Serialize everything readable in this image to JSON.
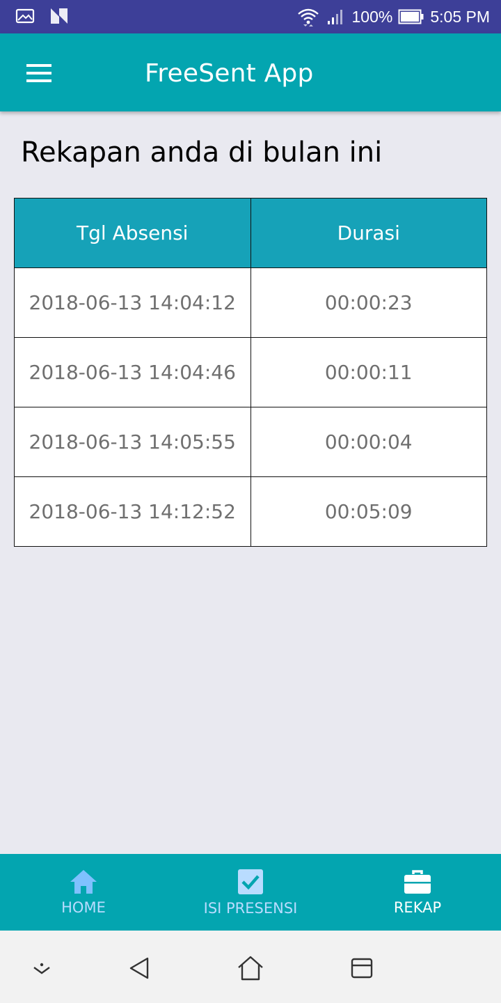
{
  "status_bar": {
    "left_icons": [
      "image-icon",
      "n-logo-icon"
    ],
    "right_icons": [
      "wifi-icon",
      "signal-icon",
      "battery-icon"
    ],
    "battery": "100%",
    "time": "5:05 PM"
  },
  "app_bar": {
    "menu_icon": "hamburger-menu-icon",
    "title": "FreeSent App"
  },
  "main": {
    "heading": "Rekapan anda di bulan ini",
    "table": {
      "columns": [
        "Tgl Absensi",
        "Durasi"
      ],
      "rows": [
        [
          "2018-06-13 14:04:12",
          "00:00:23"
        ],
        [
          "2018-06-13 14:04:46",
          "00:00:11"
        ],
        [
          "2018-06-13 14:05:55",
          "00:00:04"
        ],
        [
          "2018-06-13 14:12:52",
          "00:05:09"
        ]
      ]
    }
  },
  "bottom_nav": {
    "items": [
      {
        "label": "HOME",
        "icon": "home-icon",
        "active": false
      },
      {
        "label": "ISI PRESENSI",
        "icon": "checkbox-icon",
        "active": false
      },
      {
        "label": "REKAP",
        "icon": "briefcase-icon",
        "active": true
      }
    ]
  },
  "system_nav": {
    "buttons": [
      "collapse-icon",
      "back-icon",
      "home-icon",
      "recents-icon"
    ]
  },
  "colors": {
    "status_bar": "#3d3f98",
    "accent": "#03a5b0",
    "table_header": "#16a2b8",
    "inactive_nav": "#b9dcff",
    "background": "#e9e9f0"
  }
}
